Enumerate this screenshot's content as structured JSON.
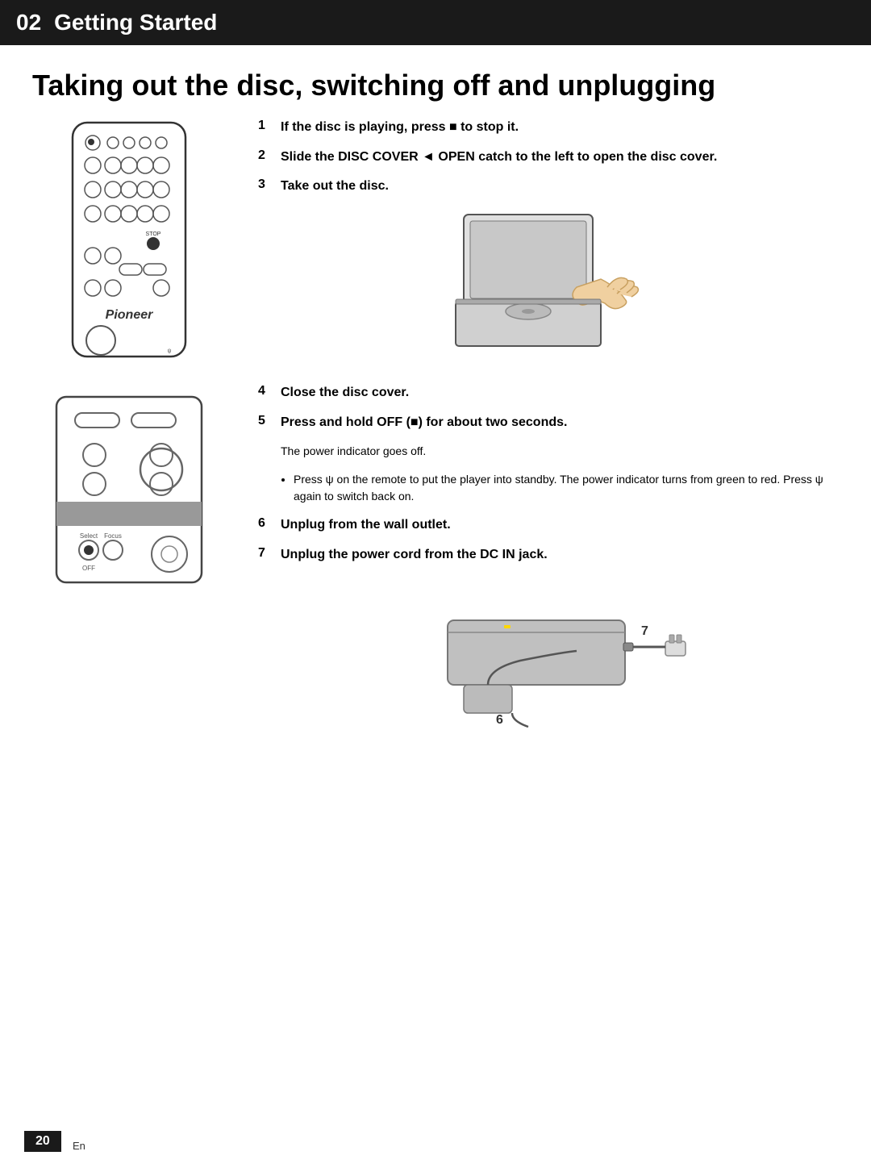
{
  "header": {
    "chapter_num": "02",
    "chapter_title": "Getting Started"
  },
  "page_title": "Taking out the disc, switching off and unplugging",
  "steps": [
    {
      "num": "1",
      "text_bold": "If the disc is playing, press ■ to stop it."
    },
    {
      "num": "2",
      "text_bold": "Slide the DISC COVER ◄ OPEN catch to the left to open the disc cover."
    },
    {
      "num": "3",
      "text_bold": "Take out the disc."
    },
    {
      "num": "4",
      "text_bold": "Close the disc cover."
    },
    {
      "num": "5",
      "text_bold": "Press and hold OFF (■) for about two seconds."
    },
    {
      "num": "6",
      "text_bold": "Unplug from the wall outlet."
    },
    {
      "num": "7",
      "text_bold": "Unplug the power cord from the DC IN jack."
    }
  ],
  "note_main": "The power indicator goes off.",
  "bullet_note": "Press ψ on the remote to put the player into standby. The power indicator turns from green to red. Press ψ again to switch back on.",
  "page_number": "20",
  "page_lang": "En"
}
